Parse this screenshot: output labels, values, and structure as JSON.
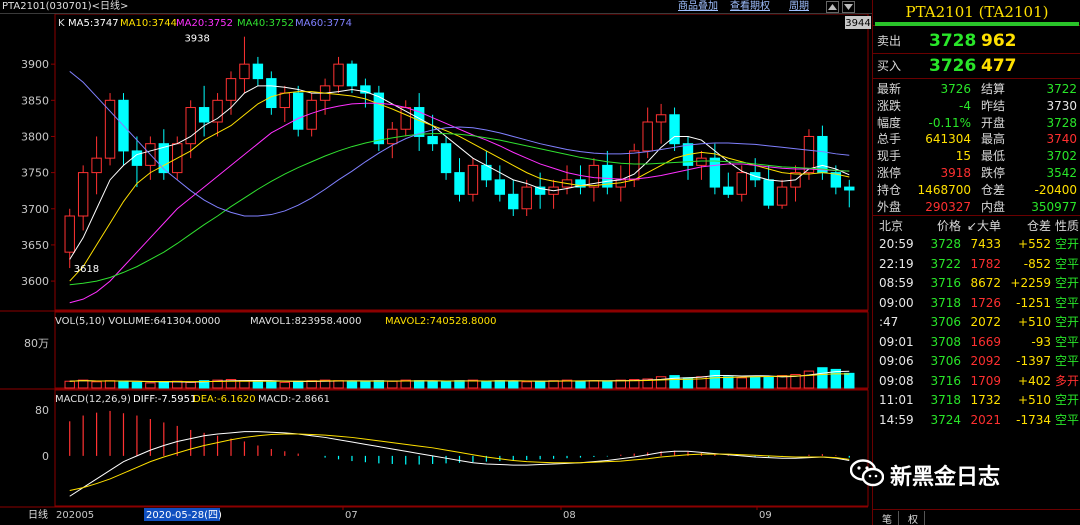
{
  "window": {
    "title": "PTA2101(030701)<日线>",
    "toolbar": [
      "商品叠加",
      "查看期权",
      "周期"
    ],
    "toolbar_icons": [
      "up-arrow-icon",
      "down-arrow-icon"
    ]
  },
  "main": {
    "k_label": "K",
    "ma": [
      {
        "label": "MA5:3747",
        "color": "#ffffff"
      },
      {
        "label": "MA10:3744",
        "color": "#ffe000"
      },
      {
        "label": "MA20:3752",
        "color": "#ff30ff"
      },
      {
        "label": "MA40:3752",
        "color": "#30e030"
      },
      {
        "label": "MA60:3774",
        "color": "#8080ff"
      }
    ],
    "price_ticks": [
      "3900",
      "3850",
      "3800",
      "3750",
      "3700",
      "3650",
      "3600"
    ],
    "high_mark": "3938",
    "low_mark": "3618",
    "right_price": "3944"
  },
  "volume": {
    "header": "VOL(5,10) VOLUME:641304.0000",
    "mavol1": "MAVOL1:823958.4000",
    "mavol2": "MAVOL2:740528.8000",
    "tick": "80万"
  },
  "macd": {
    "header": "MACD(12,26,9)",
    "diff": "DIFF:-7.5951",
    "dea": "DEA:-6.1620",
    "macd": "MACD:-2.8661",
    "ticks": [
      "80",
      "0"
    ]
  },
  "xaxis": {
    "period": "日线",
    "start": "202005",
    "cursor": "2020-05-28(四)",
    "months": [
      "07",
      "08",
      "09"
    ]
  },
  "quote": {
    "name": "PTA2101 (TA2101)",
    "sell_label": "卖出",
    "sell_price": "3728",
    "sell_vol": "962",
    "buy_label": "买入",
    "buy_price": "3726",
    "buy_vol": "477",
    "stats": [
      {
        "l1": "最新",
        "v1": "3726",
        "c1": "grn",
        "l2": "结算",
        "v2": "3722",
        "c2": "grn"
      },
      {
        "l1": "涨跌",
        "v1": "-4",
        "c1": "grn",
        "l2": "昨结",
        "v2": "3730",
        "c2": "wht"
      },
      {
        "l1": "幅度",
        "v1": "-0.11%",
        "c1": "grn",
        "l2": "开盘",
        "v2": "3728",
        "c2": "grn"
      },
      {
        "l1": "总手",
        "v1": "641304",
        "c1": "yel",
        "l2": "最高",
        "v2": "3740",
        "c2": "red"
      },
      {
        "l1": "现手",
        "v1": "15",
        "c1": "yel",
        "l2": "最低",
        "v2": "3702",
        "c2": "grn"
      },
      {
        "l1": "涨停",
        "v1": "3918",
        "c1": "red",
        "l2": "跌停",
        "v2": "3542",
        "c2": "grn"
      },
      {
        "l1": "持仓",
        "v1": "1468700",
        "c1": "yel",
        "l2": "仓差",
        "v2": "-20400",
        "c2": "yel"
      },
      {
        "l1": "外盘",
        "v1": "290327",
        "c1": "red",
        "l2": "内盘",
        "v2": "350977",
        "c2": "grn"
      }
    ],
    "tick_header": [
      "北京",
      "价格",
      "↙大单",
      "仓差",
      "性质"
    ],
    "ticks": [
      {
        "t": "20:59",
        "p": "3728",
        "q": "7433",
        "d": "+552",
        "n": "空开",
        "qc": "yel",
        "nc": "grn"
      },
      {
        "t": "22:19",
        "p": "3722",
        "q": "1782",
        "d": "-852",
        "n": "空平",
        "qc": "red",
        "nc": "grn"
      },
      {
        "t": "08:59",
        "p": "3716",
        "q": "8672",
        "d": "+2259",
        "n": "空开",
        "qc": "yel",
        "nc": "grn"
      },
      {
        "t": "09:00",
        "p": "3718",
        "q": "1726",
        "d": "-1251",
        "n": "空平",
        "qc": "red",
        "nc": "grn"
      },
      {
        "t": ":47",
        "p": "3706",
        "q": "2072",
        "d": "+510",
        "n": "空开",
        "qc": "yel",
        "nc": "grn"
      },
      {
        "t": "09:01",
        "p": "3708",
        "q": "1669",
        "d": "-93",
        "n": "空平",
        "qc": "red",
        "nc": "grn"
      },
      {
        "t": "09:06",
        "p": "3706",
        "q": "2092",
        "d": "-1397",
        "n": "空平",
        "qc": "red",
        "nc": "grn"
      },
      {
        "t": "09:08",
        "p": "3716",
        "q": "1709",
        "d": "+402",
        "n": "多开",
        "qc": "red",
        "nc": "red"
      },
      {
        "t": "11:01",
        "p": "3718",
        "q": "1732",
        "d": "+510",
        "n": "空开",
        "qc": "yel",
        "nc": "grn"
      },
      {
        "t": "14:59",
        "p": "3724",
        "q": "2021",
        "d": "-1734",
        "n": "空平",
        "qc": "red",
        "nc": "grn"
      }
    ],
    "bottom_tabs": [
      "笔",
      "权"
    ]
  },
  "watermark": "新黑金日志",
  "chart_data": {
    "type": "candlestick",
    "series": [
      {
        "o": 3640,
        "h": 3700,
        "l": 3618,
        "c": 3690
      },
      {
        "o": 3690,
        "h": 3760,
        "l": 3670,
        "c": 3750
      },
      {
        "o": 3750,
        "h": 3800,
        "l": 3720,
        "c": 3770
      },
      {
        "o": 3770,
        "h": 3860,
        "l": 3760,
        "c": 3850
      },
      {
        "o": 3850,
        "h": 3860,
        "l": 3760,
        "c": 3780
      },
      {
        "o": 3780,
        "h": 3800,
        "l": 3730,
        "c": 3760
      },
      {
        "o": 3760,
        "h": 3800,
        "l": 3740,
        "c": 3790
      },
      {
        "o": 3790,
        "h": 3810,
        "l": 3740,
        "c": 3750
      },
      {
        "o": 3750,
        "h": 3800,
        "l": 3740,
        "c": 3790
      },
      {
        "o": 3790,
        "h": 3850,
        "l": 3770,
        "c": 3840
      },
      {
        "o": 3840,
        "h": 3870,
        "l": 3800,
        "c": 3820
      },
      {
        "o": 3820,
        "h": 3860,
        "l": 3800,
        "c": 3850
      },
      {
        "o": 3850,
        "h": 3890,
        "l": 3830,
        "c": 3880
      },
      {
        "o": 3880,
        "h": 3938,
        "l": 3860,
        "c": 3900
      },
      {
        "o": 3900,
        "h": 3910,
        "l": 3870,
        "c": 3880
      },
      {
        "o": 3880,
        "h": 3890,
        "l": 3830,
        "c": 3840
      },
      {
        "o": 3840,
        "h": 3870,
        "l": 3820,
        "c": 3860
      },
      {
        "o": 3860,
        "h": 3870,
        "l": 3800,
        "c": 3810
      },
      {
        "o": 3810,
        "h": 3860,
        "l": 3800,
        "c": 3850
      },
      {
        "o": 3850,
        "h": 3880,
        "l": 3830,
        "c": 3870
      },
      {
        "o": 3870,
        "h": 3910,
        "l": 3860,
        "c": 3900
      },
      {
        "o": 3900,
        "h": 3905,
        "l": 3860,
        "c": 3870
      },
      {
        "o": 3870,
        "h": 3880,
        "l": 3840,
        "c": 3860
      },
      {
        "o": 3860,
        "h": 3870,
        "l": 3780,
        "c": 3790
      },
      {
        "o": 3790,
        "h": 3820,
        "l": 3770,
        "c": 3810
      },
      {
        "o": 3810,
        "h": 3850,
        "l": 3800,
        "c": 3840
      },
      {
        "o": 3840,
        "h": 3860,
        "l": 3780,
        "c": 3800
      },
      {
        "o": 3800,
        "h": 3830,
        "l": 3780,
        "c": 3790
      },
      {
        "o": 3790,
        "h": 3800,
        "l": 3740,
        "c": 3750
      },
      {
        "o": 3750,
        "h": 3770,
        "l": 3710,
        "c": 3720
      },
      {
        "o": 3720,
        "h": 3770,
        "l": 3710,
        "c": 3760
      },
      {
        "o": 3760,
        "h": 3780,
        "l": 3730,
        "c": 3740
      },
      {
        "o": 3740,
        "h": 3760,
        "l": 3710,
        "c": 3720
      },
      {
        "o": 3720,
        "h": 3740,
        "l": 3690,
        "c": 3700
      },
      {
        "o": 3700,
        "h": 3740,
        "l": 3690,
        "c": 3730
      },
      {
        "o": 3730,
        "h": 3750,
        "l": 3700,
        "c": 3720
      },
      {
        "o": 3720,
        "h": 3740,
        "l": 3700,
        "c": 3730
      },
      {
        "o": 3730,
        "h": 3760,
        "l": 3720,
        "c": 3740
      },
      {
        "o": 3740,
        "h": 3760,
        "l": 3720,
        "c": 3730
      },
      {
        "o": 3730,
        "h": 3770,
        "l": 3710,
        "c": 3760
      },
      {
        "o": 3760,
        "h": 3780,
        "l": 3720,
        "c": 3730
      },
      {
        "o": 3730,
        "h": 3760,
        "l": 3710,
        "c": 3740
      },
      {
        "o": 3740,
        "h": 3790,
        "l": 3730,
        "c": 3780
      },
      {
        "o": 3780,
        "h": 3840,
        "l": 3770,
        "c": 3820
      },
      {
        "o": 3820,
        "h": 3845,
        "l": 3790,
        "c": 3830
      },
      {
        "o": 3830,
        "h": 3840,
        "l": 3780,
        "c": 3790
      },
      {
        "o": 3790,
        "h": 3800,
        "l": 3740,
        "c": 3760
      },
      {
        "o": 3760,
        "h": 3780,
        "l": 3740,
        "c": 3770
      },
      {
        "o": 3770,
        "h": 3790,
        "l": 3720,
        "c": 3730
      },
      {
        "o": 3730,
        "h": 3750,
        "l": 3715,
        "c": 3720
      },
      {
        "o": 3720,
        "h": 3760,
        "l": 3710,
        "c": 3750
      },
      {
        "o": 3750,
        "h": 3770,
        "l": 3730,
        "c": 3740
      },
      {
        "o": 3740,
        "h": 3760,
        "l": 3700,
        "c": 3705
      },
      {
        "o": 3705,
        "h": 3740,
        "l": 3700,
        "c": 3730
      },
      {
        "o": 3730,
        "h": 3760,
        "l": 3710,
        "c": 3750
      },
      {
        "o": 3750,
        "h": 3810,
        "l": 3740,
        "c": 3800
      },
      {
        "o": 3800,
        "h": 3815,
        "l": 3740,
        "c": 3750
      },
      {
        "o": 3750,
        "h": 3760,
        "l": 3720,
        "c": 3730
      },
      {
        "o": 3730,
        "h": 3740,
        "l": 3702,
        "c": 3726
      }
    ],
    "price_range": [
      3560,
      3950
    ],
    "ma_series": {
      "MA5": [
        3630,
        3660,
        3700,
        3740,
        3760,
        3775,
        3780,
        3785,
        3790,
        3800,
        3815,
        3825,
        3840,
        3860,
        3870,
        3870,
        3868,
        3865,
        3860,
        3860,
        3862,
        3865,
        3862,
        3855,
        3845,
        3835,
        3825,
        3815,
        3800,
        3785,
        3770,
        3760,
        3750,
        3740,
        3735,
        3728,
        3725,
        3728,
        3732,
        3735,
        3738,
        3740,
        3748,
        3765,
        3785,
        3800,
        3800,
        3795,
        3780,
        3765,
        3752,
        3745,
        3740,
        3738,
        3740,
        3755,
        3760,
        3755,
        3747
      ],
      "MA10": [
        3600,
        3620,
        3650,
        3680,
        3710,
        3735,
        3750,
        3760,
        3770,
        3780,
        3795,
        3805,
        3815,
        3830,
        3845,
        3855,
        3860,
        3862,
        3862,
        3860,
        3858,
        3856,
        3852,
        3845,
        3838,
        3830,
        3822,
        3815,
        3808,
        3800,
        3790,
        3780,
        3770,
        3760,
        3750,
        3742,
        3738,
        3735,
        3732,
        3732,
        3734,
        3736,
        3740,
        3750,
        3760,
        3770,
        3775,
        3778,
        3776,
        3770,
        3765,
        3760,
        3755,
        3750,
        3748,
        3748,
        3750,
        3748,
        3744
      ],
      "MA20": [
        3570,
        3575,
        3585,
        3600,
        3620,
        3640,
        3660,
        3680,
        3700,
        3715,
        3730,
        3745,
        3760,
        3775,
        3790,
        3805,
        3815,
        3825,
        3832,
        3838,
        3842,
        3845,
        3846,
        3846,
        3844,
        3840,
        3834,
        3826,
        3818,
        3810,
        3802,
        3795,
        3787,
        3778,
        3770,
        3762,
        3756,
        3750,
        3746,
        3743,
        3742,
        3741,
        3741,
        3743,
        3746,
        3750,
        3754,
        3758,
        3760,
        3762,
        3762,
        3760,
        3758,
        3756,
        3755,
        3755,
        3754,
        3753,
        3752
      ],
      "MA40": [
        3595,
        3597,
        3600,
        3605,
        3612,
        3620,
        3630,
        3640,
        3652,
        3665,
        3678,
        3690,
        3703,
        3715,
        3727,
        3738,
        3748,
        3757,
        3765,
        3773,
        3780,
        3786,
        3791,
        3795,
        3798,
        3801,
        3803,
        3804,
        3804,
        3803,
        3801,
        3798,
        3795,
        3791,
        3787,
        3783,
        3779,
        3775,
        3771,
        3768,
        3765,
        3763,
        3762,
        3762,
        3763,
        3764,
        3765,
        3766,
        3766,
        3765,
        3764,
        3762,
        3760,
        3758,
        3757,
        3756,
        3755,
        3753,
        3752
      ],
      "MA60": [
        3890,
        3875,
        3855,
        3835,
        3815,
        3795,
        3775,
        3755,
        3740,
        3725,
        3712,
        3702,
        3695,
        3690,
        3690,
        3692,
        3697,
        3705,
        3715,
        3727,
        3740,
        3752,
        3765,
        3777,
        3788,
        3797,
        3804,
        3809,
        3812,
        3813,
        3812,
        3809,
        3805,
        3800,
        3795,
        3790,
        3786,
        3782,
        3779,
        3777,
        3776,
        3776,
        3777,
        3779,
        3782,
        3785,
        3788,
        3790,
        3791,
        3791,
        3790,
        3789,
        3787,
        3785,
        3783,
        3781,
        3779,
        3776,
        3774
      ]
    },
    "volume_wan": [
      12,
      14,
      11,
      13,
      12,
      10,
      9,
      11,
      12,
      10,
      13,
      14,
      15,
      13,
      12,
      11,
      10,
      12,
      13,
      14,
      13,
      12,
      11,
      13,
      12,
      14,
      13,
      12,
      11,
      13,
      14,
      12,
      13,
      12,
      11,
      12,
      13,
      14,
      12,
      13,
      12,
      14,
      15,
      16,
      20,
      22,
      18,
      20,
      31,
      20,
      18,
      20,
      19,
      22,
      24,
      30,
      36,
      33,
      26
    ],
    "macd_hist": [
      60,
      70,
      75,
      78,
      74,
      70,
      64,
      58,
      52,
      45,
      40,
      35,
      30,
      25,
      18,
      12,
      8,
      4,
      0,
      -3,
      -6,
      -9,
      -11,
      -13,
      -14,
      -15,
      -15,
      -14,
      -13,
      -12,
      -11,
      -10,
      -9,
      -8,
      -7,
      -6,
      -5,
      -4,
      -3,
      -2,
      -1,
      2,
      4,
      6,
      8,
      9,
      7,
      5,
      3,
      1,
      0,
      -1,
      -2,
      -1,
      0,
      2,
      3,
      1,
      -3
    ],
    "macd_diff": [
      -70,
      -55,
      -40,
      -25,
      -10,
      0,
      10,
      18,
      25,
      30,
      35,
      38,
      40,
      42,
      42,
      41,
      40,
      38,
      35,
      32,
      28,
      24,
      20,
      16,
      12,
      8,
      4,
      0,
      -4,
      -8,
      -12,
      -14,
      -15,
      -16,
      -16,
      -15,
      -14,
      -13,
      -12,
      -10,
      -8,
      -5,
      -2,
      2,
      6,
      8,
      8,
      6,
      4,
      2,
      0,
      -2,
      -3,
      -4,
      -4,
      -3,
      -2,
      -4,
      -8
    ],
    "macd_dea": [
      -60,
      -55,
      -48,
      -40,
      -30,
      -20,
      -10,
      -2,
      5,
      12,
      18,
      23,
      28,
      32,
      35,
      37,
      38,
      38,
      37,
      36,
      34,
      32,
      29,
      26,
      23,
      20,
      17,
      14,
      10,
      6,
      2,
      -2,
      -5,
      -8,
      -10,
      -11,
      -12,
      -12,
      -12,
      -11,
      -10,
      -9,
      -7,
      -5,
      -2,
      0,
      2,
      3,
      3,
      3,
      2,
      1,
      0,
      -1,
      -2,
      -2,
      -2,
      -3,
      -6
    ],
    "macd_range": [
      -80,
      90
    ],
    "volume_range_wan": [
      0,
      110
    ]
  }
}
